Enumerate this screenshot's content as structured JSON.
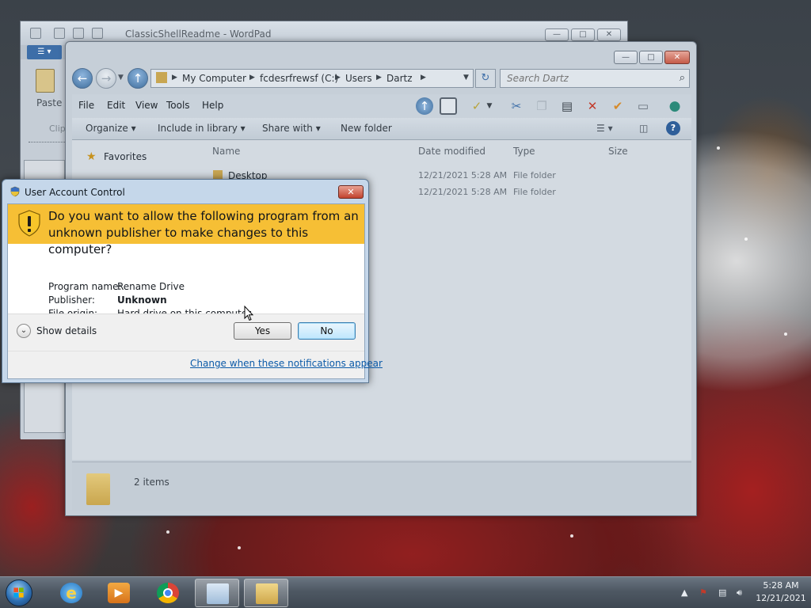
{
  "wordpad": {
    "title": "ClassicShellReadme - WordPad",
    "paste_label": "Paste",
    "clipboard_label": "Clip"
  },
  "explorer": {
    "breadcrumb": [
      "My Computer",
      "fcdesrfrewsf (C:)",
      "Users",
      "Dartz"
    ],
    "search_placeholder": "Search Dartz",
    "menu": [
      "File",
      "Edit",
      "View",
      "Tools",
      "Help"
    ],
    "commands": {
      "organize": "Organize",
      "include_in_library": "Include in library",
      "share_with": "Share with",
      "new_folder": "New folder"
    },
    "nav": {
      "favorites": "Favorites"
    },
    "columns": {
      "name": "Name",
      "date_modified": "Date modified",
      "type": "Type",
      "size": "Size"
    },
    "files": [
      {
        "name": "Desktop",
        "date": "12/21/2021 5:28 AM",
        "type": "File folder"
      },
      {
        "name": "",
        "date": "12/21/2021 5:28 AM",
        "type": "File folder"
      }
    ],
    "item_count": "2 items"
  },
  "uac": {
    "title": "User Account Control",
    "question": "Do you want to allow the following program from an unknown publisher to make changes to this computer?",
    "program_name_label": "Program name:",
    "program_name": "Rename Drive",
    "publisher_label": "Publisher:",
    "publisher": "Unknown",
    "file_origin_label": "File origin:",
    "file_origin": "Hard drive on this computer",
    "show_details": "Show details",
    "yes": "Yes",
    "no": "No",
    "change_link": "Change when these notifications appear",
    "banner_color": "#f6bf35"
  },
  "taskbar": {
    "apps": [
      "internet-explorer",
      "media-player",
      "chrome",
      "wordpad",
      "windows-explorer"
    ],
    "clock_time": "5:28 AM",
    "clock_date": "12/21/2021"
  }
}
